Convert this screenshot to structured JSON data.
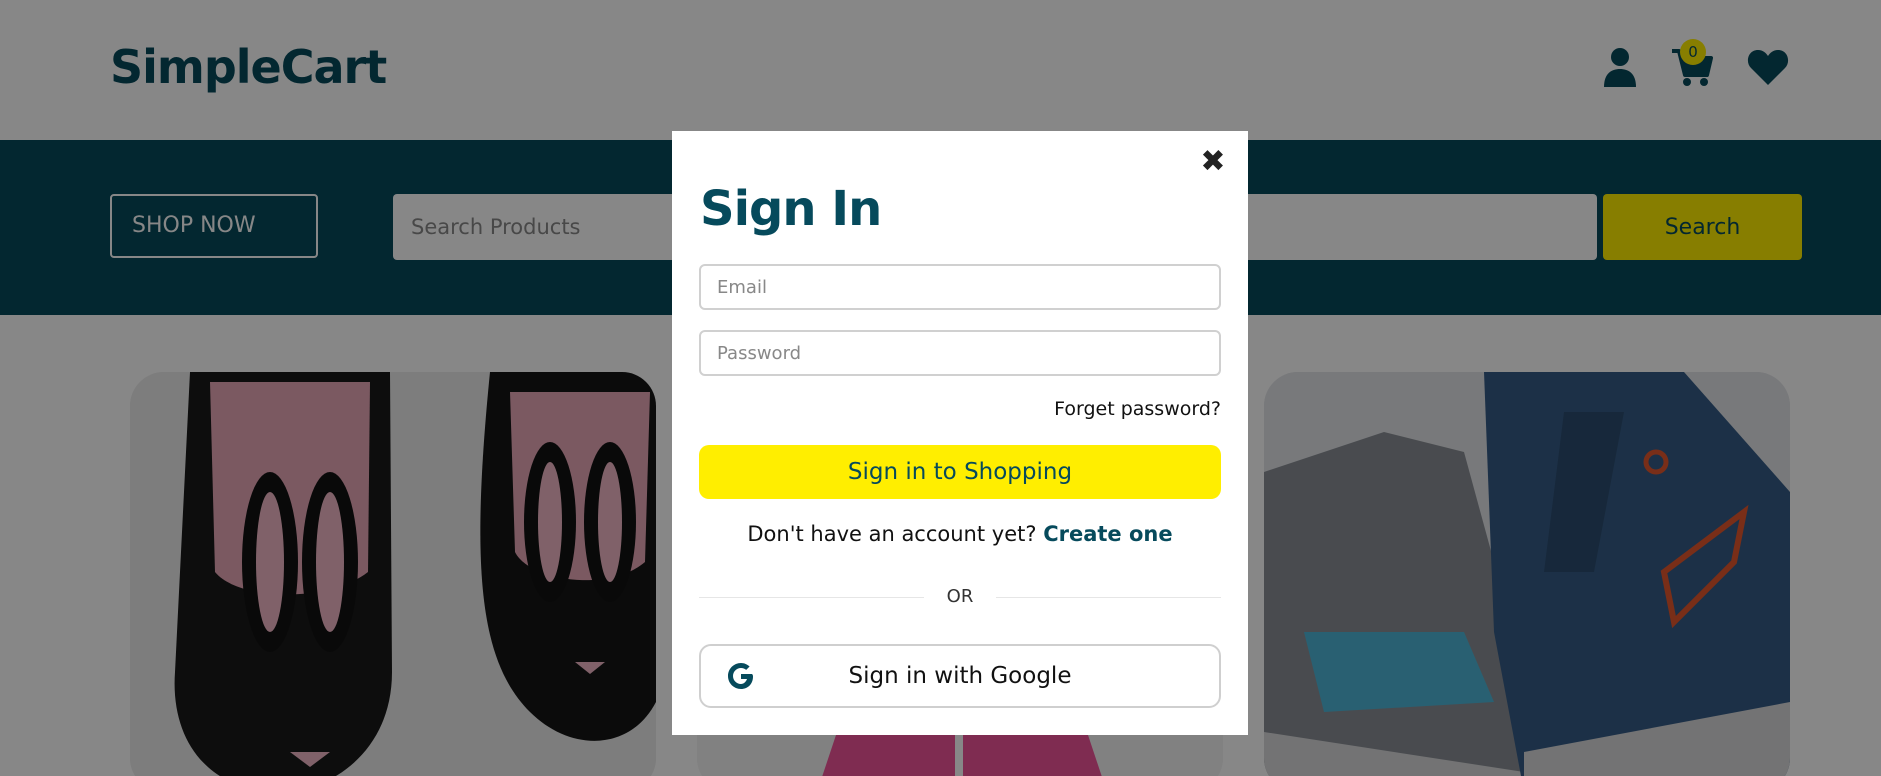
{
  "header": {
    "logo": "SimpleCart",
    "icons": [
      "user-icon",
      "cart-icon",
      "heart-icon"
    ],
    "cart_count": "0"
  },
  "hero": {
    "shop_now_label": "SHOP NOW",
    "search_placeholder": "Search Products",
    "search_button_label": "Search"
  },
  "products": [
    {
      "image": "black bunny-face baby shoes"
    },
    {
      "image": "pink jacket"
    },
    {
      "image": "blue running sneaker"
    }
  ],
  "modal": {
    "close_icon": "close-icon",
    "title": "Sign In",
    "email_placeholder": "Email",
    "password_placeholder": "Password",
    "forgot_password": "Forget password?",
    "signin_button": "Sign in to Shopping",
    "no_account_text": "Don't have an account yet?",
    "create_link": "Create one",
    "or_text": "OR",
    "google_button": "Sign in with Google"
  },
  "colors": {
    "brand": "#064a5c",
    "accent": "#ffee00",
    "overlay": "rgba(0,0,0,0.47)"
  }
}
